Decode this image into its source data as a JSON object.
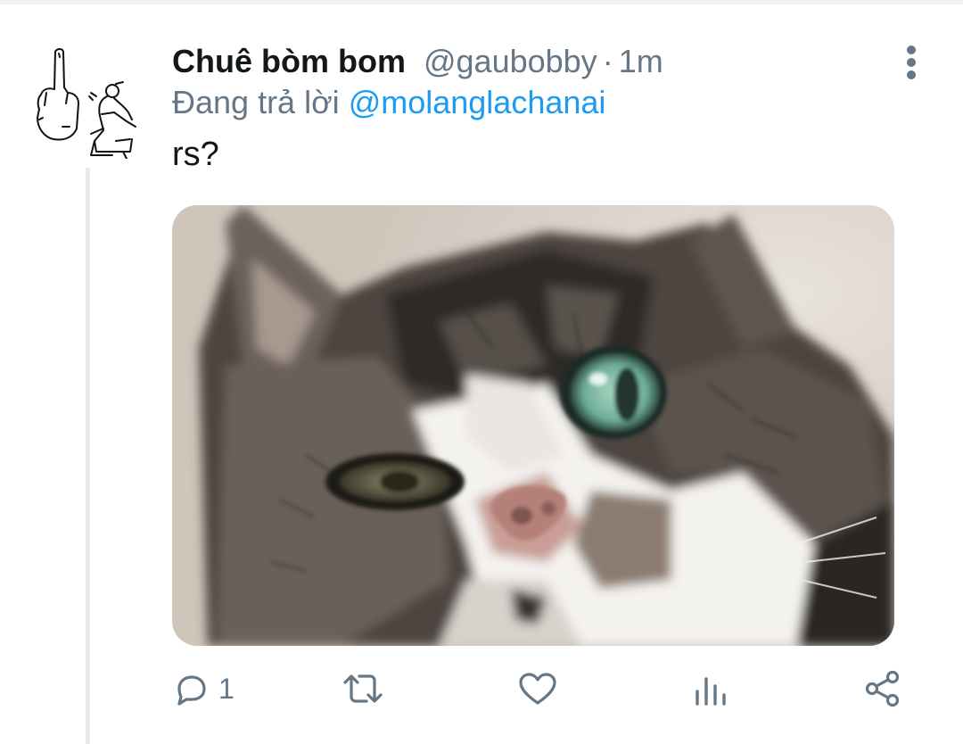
{
  "tweet": {
    "display_name": "Chuê bòm bom",
    "handle": "@gaubobby",
    "separator": "·",
    "time": "1m",
    "reply_prefix": "Đang trả lời",
    "reply_to": "@molanglachanai",
    "text": "rs?",
    "media": {
      "description_icon": "cat-photo"
    }
  },
  "actions": {
    "reply": {
      "icon": "reply-icon",
      "count": "1"
    },
    "retweet": {
      "icon": "retweet-icon",
      "count": ""
    },
    "like": {
      "icon": "heart-icon",
      "count": ""
    },
    "analytics": {
      "icon": "analytics-icon",
      "count": ""
    },
    "share": {
      "icon": "share-icon",
      "count": ""
    }
  },
  "colors": {
    "text_primary": "#14171a",
    "text_secondary": "#657786",
    "link": "#1d9bf0",
    "thread_line": "#e7e9ea"
  }
}
